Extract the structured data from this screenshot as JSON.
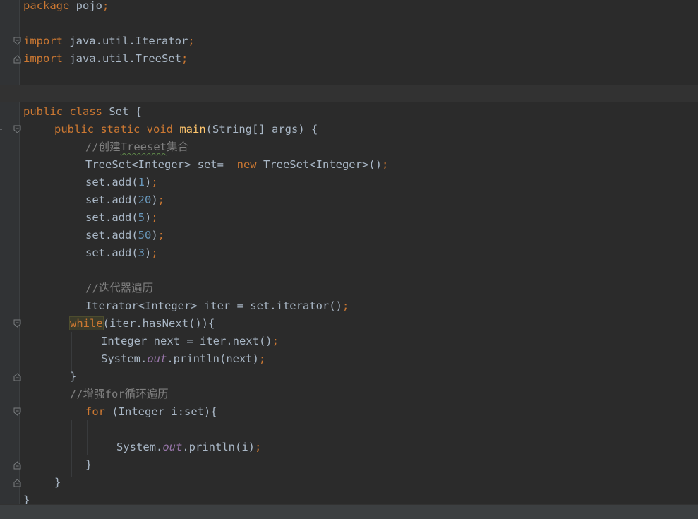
{
  "editor": {
    "language": "Java",
    "lines": {
      "l1_package": "package",
      "l1_name": " pojo",
      "l1_semi": ";",
      "l3_import": "import",
      "l3_name": " java.util.Iterator",
      "l3_semi": ";",
      "l4_import": "import",
      "l4_name": " java.util.TreeSet",
      "l4_semi": ";",
      "l7_public": "public",
      "l7_class": " class",
      "l7_rest": " Set {",
      "l8_public": "public",
      "l8_static": " static",
      "l8_void": " void",
      "l8_main": " main",
      "l8_rest": "(String[] args) {",
      "l9_comment_a": "//创建",
      "l9_comment_b": "Treeset",
      "l9_comment_c": "集合",
      "l10_a": "TreeSet<Integer> set=  ",
      "l10_new": "new",
      "l10_b": " TreeSet<Integer>()",
      "l10_semi": ";",
      "l11_a": "set.add(",
      "l11_num": "1",
      "l11_b": ")",
      "l11_semi": ";",
      "l12_a": "set.add(",
      "l12_num": "20",
      "l12_b": ")",
      "l12_semi": ";",
      "l13_a": "set.add(",
      "l13_num": "5",
      "l13_b": ")",
      "l13_semi": ";",
      "l14_a": "set.add(",
      "l14_num": "50",
      "l14_b": ")",
      "l14_semi": ";",
      "l15_a": "set.add(",
      "l15_num": "3",
      "l15_b": ")",
      "l15_semi": ";",
      "l17_comment": "//迭代器遍历",
      "l18_a": "Iterator<Integer> iter = set.iterator()",
      "l18_semi": ";",
      "l19_while": "while",
      "l19_rest": "(iter.hasNext()){",
      "l20_a": "Integer next = iter.next()",
      "l20_semi": ";",
      "l21_a": "System.",
      "l21_out": "out",
      "l21_b": ".println(next)",
      "l21_semi": ";",
      "l22_close": "}",
      "l23_comment": "//增强for循环遍历",
      "l24_for": "for",
      "l24_rest": " (Integer i:set){",
      "l26_a": "System.",
      "l26_out": "out",
      "l26_b": ".println(i)",
      "l26_semi": ";",
      "l27_close": "}",
      "l28_close": "}",
      "l29_close": "}"
    }
  }
}
